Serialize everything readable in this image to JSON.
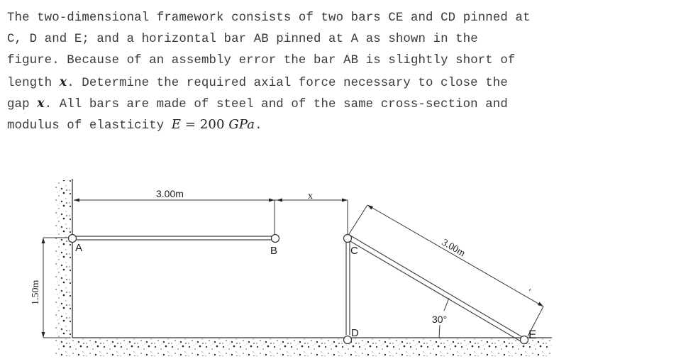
{
  "problem": {
    "lines": [
      "The two-dimensional framework consists of two bars CE and CD pinned at",
      "C, D and E; and a horizontal bar AB pinned at A as shown in the",
      "figure. Because of an assembly error the bar AB is slightly short of"
    ],
    "line4_pre": "length ",
    "line4_var": "x",
    "line4_post": ". Determine the required axial force necessary to close the",
    "line5_pre": "gap ",
    "line5_var": "x",
    "line5_post": ". All bars are made of steel and of the same cross-section and",
    "line6_pre": "modulus of elasticity ",
    "line6_eq_var": "E",
    "line6_eq_rest": " = 200 ",
    "line6_eq_unit": "GPa",
    "line6_post": "."
  },
  "diagram": {
    "dims": {
      "ab_length": "3.00m",
      "gap": "x",
      "ce_length": "3.00m",
      "height": "1.50m",
      "angle": "30°"
    },
    "nodes": {
      "A": "A",
      "B": "B",
      "C": "C",
      "D": "D",
      "E": "E"
    },
    "angle_deg": 30
  }
}
